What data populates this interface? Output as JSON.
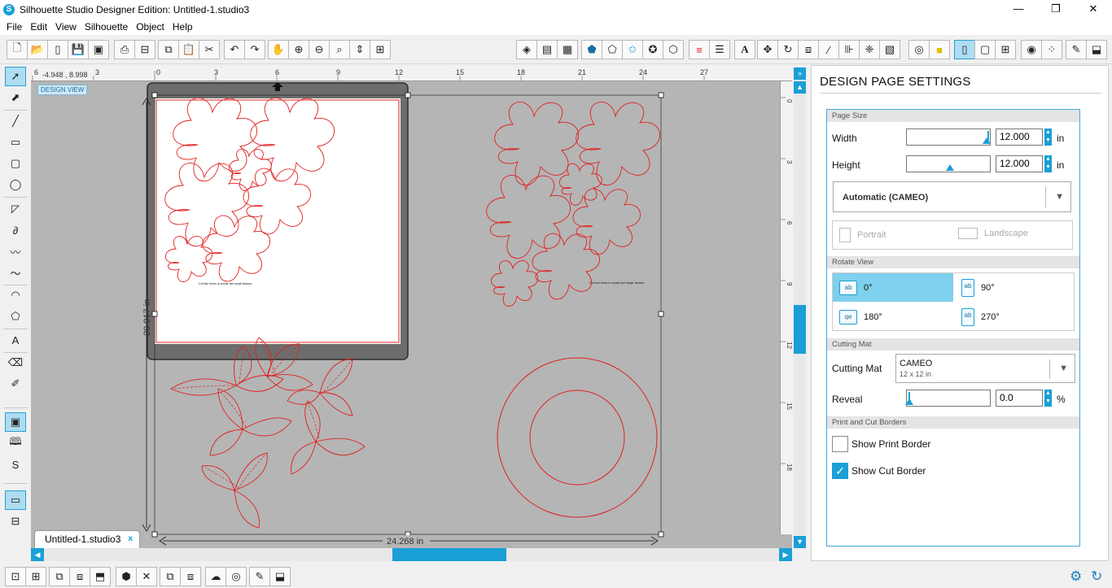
{
  "window": {
    "title": "Silhouette Studio Designer Edition: Untitled-1.studio3",
    "logo": "S",
    "minimize": "—",
    "maximize": "❐",
    "close": "✕"
  },
  "menu": [
    "File",
    "Edit",
    "View",
    "Silhouette",
    "Object",
    "Help"
  ],
  "ruler": {
    "coordinate": "-4.948 , 8.998",
    "top_ticks": [
      "6",
      "3",
      "0",
      "3",
      "6",
      "9",
      "12",
      "15",
      "18",
      "21",
      "24",
      "27"
    ],
    "right_ticks": [
      "0",
      "3",
      "6",
      "9",
      "12",
      "15",
      "18"
    ]
  },
  "canvas": {
    "design_view_label": "DESIGN VIEW",
    "height_dimension": "20.917 in",
    "width_dimension": "24.268 in",
    "note_left": "Cut five times to create five small flowers.",
    "note_right": "Cut four times to create four larger flowers."
  },
  "document_tab": {
    "label": "Untitled-1.studio3",
    "close": "x"
  },
  "panel": {
    "collapse_glyph": "»",
    "title": "DESIGN PAGE SETTINGS",
    "page_size": {
      "header": "Page Size",
      "width_label": "Width",
      "width_value": "12.000",
      "width_unit": "in",
      "height_label": "Height",
      "height_value": "12.000",
      "height_unit": "in",
      "media": "Automatic (CAMEO)",
      "portrait": "Portrait",
      "landscape": "Landscape"
    },
    "rotate_view": {
      "header": "Rotate View",
      "options": [
        "0°",
        "90°",
        "180°",
        "270°"
      ],
      "selected": "0°"
    },
    "cutting_mat": {
      "header": "Cutting Mat",
      "label": "Cutting Mat",
      "value": "CAMEO",
      "sub": "12 x 12 in",
      "reveal_label": "Reveal",
      "reveal_value": "0.0",
      "reveal_unit": "%"
    },
    "borders": {
      "header": "Print and Cut Borders",
      "show_print_border": "Show Print Border",
      "show_print_border_checked": false,
      "show_cut_border": "Show Cut Border",
      "show_cut_border_checked": true
    }
  },
  "icons": {
    "toolbar_file": [
      "new-document-icon",
      "open-icon",
      "template-icon",
      "save-icon",
      "save-library-icon",
      "print-icon",
      "send-to-silhouette-icon",
      "copy-icon",
      "paste-icon",
      "cut-icon",
      "undo-icon",
      "redo-icon",
      "pan-icon",
      "zoom-in-icon",
      "zoom-out-icon",
      "zoom-select-icon",
      "drag-zoom-icon",
      "fit-to-page-icon"
    ],
    "toolbar_panels": [
      "fill-color-icon",
      "gradient-icon",
      "fill-pattern-icon",
      "line-color-icon",
      "line-style-icon",
      "sketch-icon",
      "rhinestone-icon",
      "shape-icon",
      "align-icon",
      "line-width-icon",
      "text-style-icon",
      "transform-icon",
      "replicate-icon",
      "modify-icon",
      "offset-icon",
      "trace-icon",
      "nesting-icon",
      "library-icon",
      "design-store-icon",
      "page-setup-icon",
      "cut-settings-icon",
      "grid-icon",
      "registration-icon",
      "print-cut-icon",
      "send-icon",
      "media-icon"
    ],
    "colors": {
      "accent": "#1a9fd6",
      "cut_line": "#e02020",
      "canvas": "#b5b5b5"
    }
  }
}
